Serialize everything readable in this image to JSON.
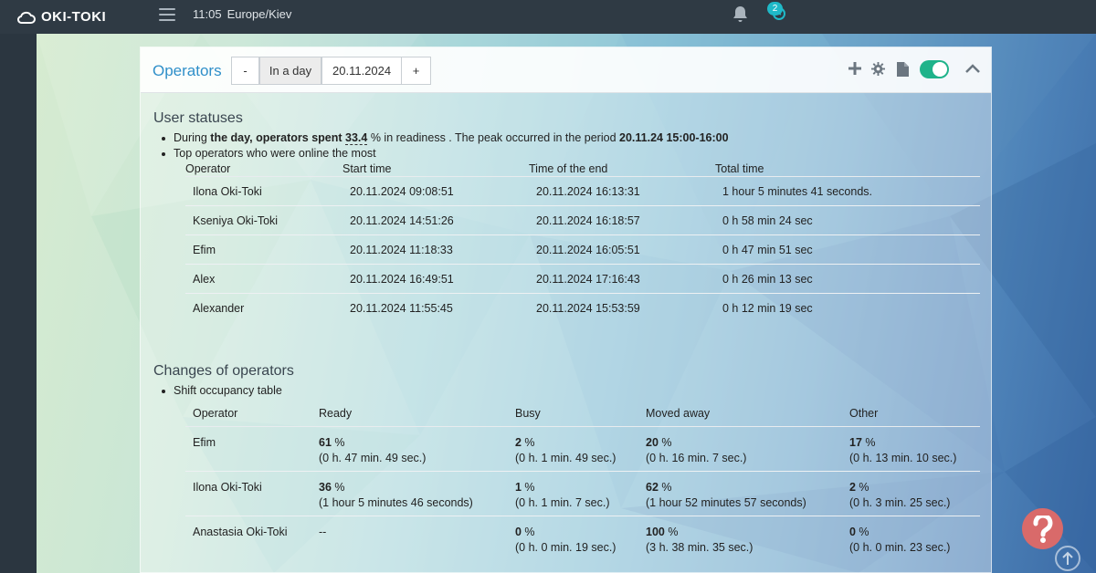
{
  "app": {
    "logo_text": "OKI-TOKI"
  },
  "topbar": {
    "time": "11:05",
    "timezone": "Europe/Kiev",
    "notifications_badge": "2"
  },
  "panel": {
    "title": "Operators",
    "minus_label": "-",
    "period_label": "In a day",
    "date_value": "20.11.2024",
    "plus_label": "+"
  },
  "user_statuses": {
    "title": "User statuses",
    "summary": {
      "prefix": "During ",
      "bold_phrase": "the day, operators spent",
      "percent": "33.4",
      "middle": " % in readiness . The peak occurred in the period ",
      "peak": "20.11.24 15:00-16:00"
    },
    "top_label": "Top operators who were online the most",
    "columns": [
      "Operator",
      "Start time",
      "Time of the end",
      "Total time"
    ],
    "rows": [
      {
        "operator": "Ilona Oki-Toki",
        "start": "20.11.2024 09:08:51",
        "end": "20.11.2024 16:13:31",
        "total": "1 hour 5 minutes 41 seconds."
      },
      {
        "operator": "Kseniya Oki-Toki",
        "start": "20.11.2024 14:51:26",
        "end": "20.11.2024 16:18:57",
        "total": "0 h 58 min 24 sec"
      },
      {
        "operator": "Efim",
        "start": "20.11.2024 11:18:33",
        "end": "20.11.2024 16:05:51",
        "total": "0 h 47 min 51 sec"
      },
      {
        "operator": "Alex",
        "start": "20.11.2024 16:49:51",
        "end": "20.11.2024 17:16:43",
        "total": "0 h 26 min 13 sec"
      },
      {
        "operator": "Alexander",
        "start": "20.11.2024 11:55:45",
        "end": "20.11.2024 15:53:59",
        "total": "0 h 12 min 19 sec"
      }
    ]
  },
  "changes": {
    "title": "Changes of operators",
    "table_label": "Shift occupancy table",
    "columns": [
      "Operator",
      "Ready",
      "Busy",
      "Moved away",
      "Other"
    ],
    "rows": [
      {
        "operator": "Efim",
        "ready": {
          "pct": "61",
          "unit": " %",
          "dur": "(0 h. 47 min. 49 sec.)"
        },
        "busy": {
          "pct": "2",
          "unit": " %",
          "dur": "(0 h. 1 min. 49 sec.)"
        },
        "away": {
          "pct": "20",
          "unit": " %",
          "dur": "(0 h. 16 min. 7 sec.)"
        },
        "other": {
          "pct": "17",
          "unit": " %",
          "dur": "(0 h. 13 min. 10 sec.)"
        }
      },
      {
        "operator": "Ilona Oki-Toki",
        "ready": {
          "pct": "36",
          "unit": " %",
          "dur": "(1 hour 5 minutes 46 seconds)"
        },
        "busy": {
          "pct": "1",
          "unit": " %",
          "dur": "(0 h. 1 min. 7 sec.)"
        },
        "away": {
          "pct": "62",
          "unit": " %",
          "dur": "(1 hour 52 minutes 57 seconds)"
        },
        "other": {
          "pct": "2",
          "unit": " %",
          "dur": "(0 h. 3 min. 25 sec.)"
        }
      },
      {
        "operator": "Anastasia Oki-Toki",
        "ready": {
          "pct": "--",
          "unit": "",
          "dur": ""
        },
        "busy": {
          "pct": "0",
          "unit": " %",
          "dur": "(0 h. 0 min. 19 sec.)"
        },
        "away": {
          "pct": "100",
          "unit": " %",
          "dur": "(3 h. 38 min. 35 sec.)"
        },
        "other": {
          "pct": "0",
          "unit": " %",
          "dur": "(0 h. 0 min. 23 sec.)"
        }
      }
    ]
  },
  "colors": {
    "accent": "#2f8fc9",
    "toggle_on": "#1fb38a",
    "help": "#d96a6a",
    "badge": "#1fb9c8"
  },
  "icons": [
    "cloud-logo-icon",
    "menu-icon",
    "bell-icon",
    "history-icon",
    "plus-icon",
    "gear-icon",
    "document-icon",
    "chevron-up-icon",
    "question-icon",
    "arrow-up-icon"
  ]
}
